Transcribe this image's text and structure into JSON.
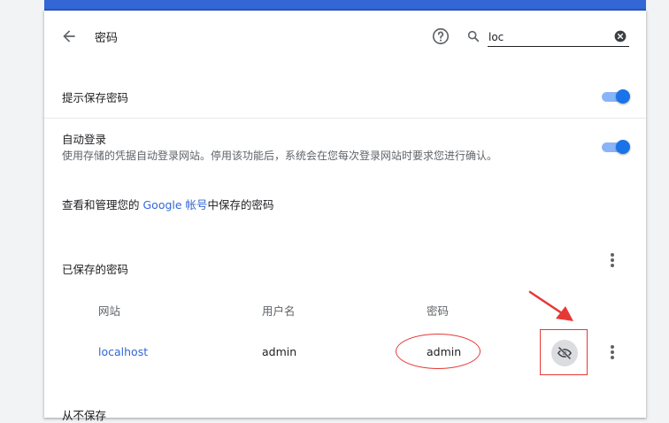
{
  "page": {
    "title": "密码"
  },
  "search": {
    "value": "loc",
    "placeholder": ""
  },
  "settings": {
    "offer_to_save": {
      "label": "提示保存密码",
      "enabled": true
    },
    "auto_signin": {
      "label": "自动登录",
      "description": "使用存储的凭据自动登录网站。停用该功能后，系统会在您每次登录网站时要求您进行确认。",
      "enabled": true
    },
    "manage": {
      "prefix": "查看和管理您的 ",
      "link": "Google 帐号",
      "suffix": "中保存的密码"
    }
  },
  "saved_passwords": {
    "heading": "已保存的密码",
    "columns": {
      "site": "网站",
      "username": "用户名",
      "password": "密码"
    },
    "rows": [
      {
        "site": "localhost",
        "username": "admin",
        "password": "admin"
      }
    ]
  },
  "next_section_cut": "从不保存",
  "colors": {
    "accent": "#1a73e8",
    "link": "#3367d6",
    "annotation": "#e53935",
    "header_bar": "#3367d6"
  },
  "icons": {
    "back": "arrow-back-icon",
    "help": "help-circle-icon",
    "search": "search-icon",
    "clear": "clear-icon",
    "more": "more-vert-icon",
    "visibility_off": "visibility-off-icon"
  }
}
